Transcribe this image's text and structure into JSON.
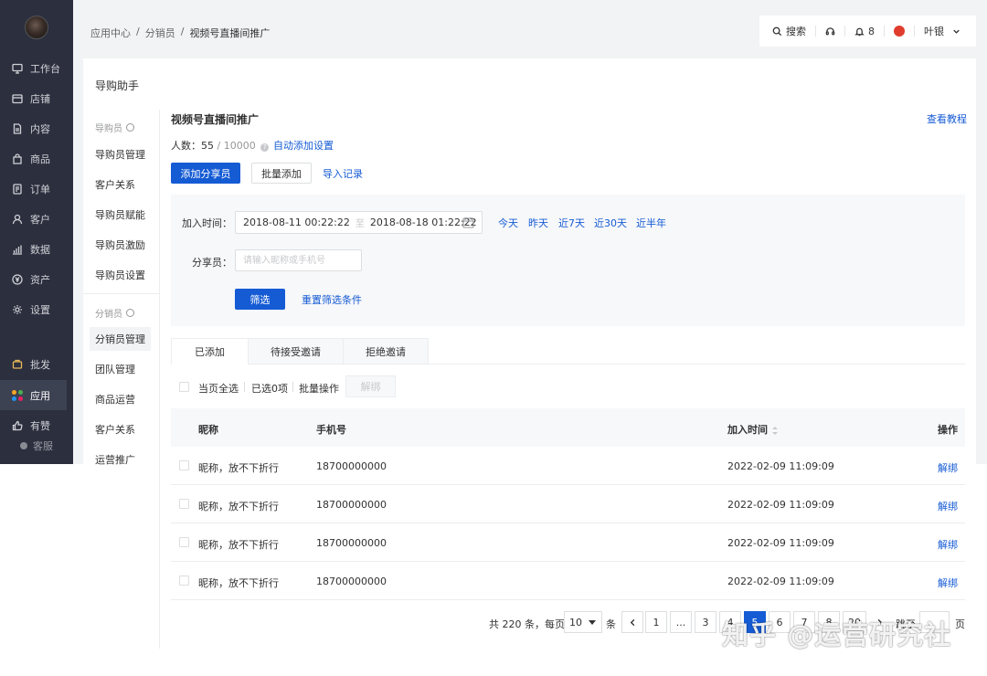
{
  "sidebar": {
    "items": [
      {
        "label": "工作台",
        "icon": "monitor-icon"
      },
      {
        "label": "店铺",
        "icon": "shop-icon"
      },
      {
        "label": "内容",
        "icon": "document-icon"
      },
      {
        "label": "商品",
        "icon": "bag-icon"
      },
      {
        "label": "订单",
        "icon": "order-icon"
      },
      {
        "label": "客户",
        "icon": "user-icon"
      },
      {
        "label": "数据",
        "icon": "bar-chart-icon"
      },
      {
        "label": "资产",
        "icon": "yen-icon"
      },
      {
        "label": "设置",
        "icon": "gear-icon"
      }
    ],
    "bottom": [
      {
        "label": "批发",
        "icon": "wholesale-icon"
      },
      {
        "label": "应用",
        "icon": "apps-icon"
      },
      {
        "label": "有赞",
        "icon": "thumb-icon"
      }
    ],
    "kefu": "客服"
  },
  "breadcrumb": {
    "a": "应用中心",
    "b": "分销员",
    "c": "视频号直播间推广",
    "sep": "/"
  },
  "topbar": {
    "search": "搜索",
    "notifications": "8",
    "user": "叶银"
  },
  "page_title": "导购助手",
  "subnav": {
    "group1": "导购员",
    "group1_items": [
      "导购员管理",
      "客户关系",
      "导购员赋能",
      "导购员激励",
      "导购员设置"
    ],
    "group2": "分销员",
    "group2_items": [
      "分销员管理",
      "团队管理",
      "商品运营",
      "客户关系",
      "运营推广"
    ]
  },
  "section": {
    "title": "视频号直播间推广",
    "tutorial": "查看教程",
    "count_label": "人数：",
    "count": "55",
    "count_max": "/ 10000",
    "auto_add": "自动添加设置",
    "add_button": "添加分享员",
    "batch_add_button": "批量添加",
    "import_record": "导入记录"
  },
  "filter": {
    "join_time_label": "加入时间：",
    "start": "2018-08-11 00:22:22",
    "to": "至",
    "end": "2018-08-18 01:22:22",
    "quick": [
      "今天",
      "昨天",
      "近7天",
      "近30天",
      "近半年"
    ],
    "sharer_label": "分享员：",
    "sharer_placeholder": "请输入昵称或手机号",
    "filter_button": "筛选",
    "reset": "重置筛选条件"
  },
  "tabs": [
    "已添加",
    "待接受邀请",
    "拒绝邀请"
  ],
  "batch": {
    "select_page": "当页全选",
    "selected": "已选0项",
    "batch_op": "批量操作",
    "unbind": "解绑"
  },
  "table": {
    "headers": {
      "nickname": "昵称",
      "phone": "手机号",
      "join_time": "加入时间",
      "action": "操作"
    },
    "rows": [
      {
        "nickname": "昵称，放不下折行",
        "phone": "18700000000",
        "time": "2022-02-09 11:09:09",
        "action": "解绑"
      },
      {
        "nickname": "昵称，放不下折行",
        "phone": "18700000000",
        "time": "2022-02-09 11:09:09",
        "action": "解绑"
      },
      {
        "nickname": "昵称，放不下折行",
        "phone": "18700000000",
        "time": "2022-02-09 11:09:09",
        "action": "解绑"
      },
      {
        "nickname": "昵称，放不下折行",
        "phone": "18700000000",
        "time": "2022-02-09 11:09:09",
        "action": "解绑"
      }
    ]
  },
  "pagination": {
    "total": "共 220 条，每页",
    "size": "10",
    "unit": "条",
    "pages": [
      "1",
      "...",
      "3",
      "4",
      "5",
      "6",
      "7",
      "8",
      "...",
      "20"
    ],
    "current": "5",
    "goto": "跳至",
    "page": "页"
  },
  "watermark": "知乎 @运营研究社",
  "colors": {
    "accent": "#155bd4",
    "sidebar": "#2b2f3e"
  }
}
